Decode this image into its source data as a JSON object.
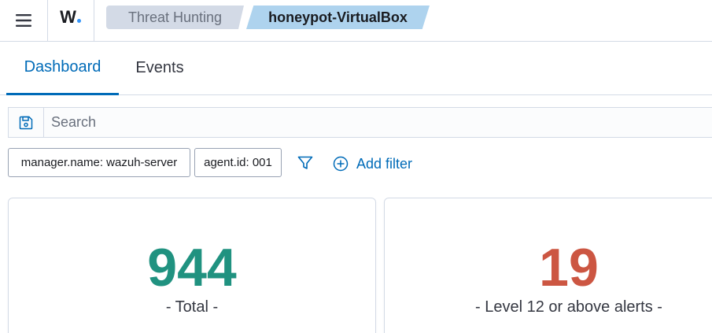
{
  "header": {
    "logo_text": "W",
    "breadcrumbs": [
      "Threat Hunting",
      "honeypot-VirtualBox"
    ]
  },
  "tabs": [
    {
      "label": "Dashboard",
      "active": true
    },
    {
      "label": "Events",
      "active": false
    }
  ],
  "search": {
    "placeholder": "Search",
    "value": ""
  },
  "filters": {
    "items": [
      "manager.name: wazuh-server",
      "agent.id: 001"
    ],
    "add_filter_label": "Add filter"
  },
  "stats": [
    {
      "value": "944",
      "label": "- Total -",
      "color": "#209280"
    },
    {
      "value": "19",
      "label": "- Level 12 or above alerts -",
      "color": "#cc5642"
    }
  ],
  "colors": {
    "accent": "#006bb8",
    "breadcrumb_active": "#aed3ee",
    "breadcrumb_inactive": "#d3dae6"
  },
  "icons": {
    "menu": "hamburger-menu-icon",
    "save": "save-icon",
    "filter": "filter-icon",
    "add": "plus-circle-icon"
  }
}
